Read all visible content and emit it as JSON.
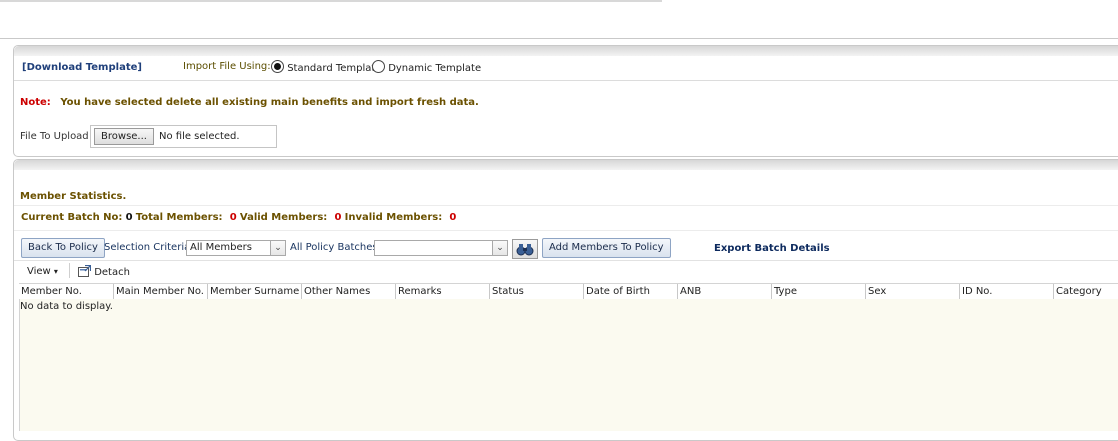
{
  "import": {
    "download_link": "[Download Template]",
    "import_label": "Import File Using:",
    "options": [
      {
        "label": "Standard Template",
        "selected": true
      },
      {
        "label": "Dynamic Template",
        "selected": false
      }
    ],
    "note_label": "Note:",
    "note_text": "You have selected delete all existing main benefits and import fresh data.",
    "file_label": "File To Upload",
    "browse_label": "Browse...",
    "file_status": "No file selected."
  },
  "stats": {
    "title": "Member Statistics.",
    "batch_label": "Current Batch No:",
    "batch_value": "0",
    "total_label": "Total Members:",
    "total_value": "0",
    "valid_label": "Valid Members:",
    "valid_value": "0",
    "invalid_label": "Invalid Members:",
    "invalid_value": "0"
  },
  "toolbar": {
    "back_label": "Back To Policy",
    "criteria_label": "Selection Criteria",
    "criteria_value": "All Members",
    "batches_label": "All Policy Batches",
    "batches_value": "",
    "add_label": "Add Members To Policy",
    "export_label": "Export Batch Details",
    "view_label": "View",
    "detach_label": "Detach"
  },
  "table": {
    "columns": [
      "Member No.",
      "Main Member No.",
      "Member Surname",
      "Other Names",
      "Remarks",
      "Status",
      "Date of Birth",
      "ANB",
      "Type",
      "Sex",
      "ID No.",
      "Category"
    ],
    "empty_text": "No data to display."
  },
  "colors": {
    "note_red": "#cc0000",
    "invalid_red": "#cc0000",
    "label_olive": "#6b5100",
    "link_blue": "#1f3f7a",
    "grid_body": "#fbfaf0"
  },
  "icons": {
    "binoculars": "binoculars-icon",
    "detach": "detach-icon",
    "view_menu": "chevron-down-icon"
  }
}
